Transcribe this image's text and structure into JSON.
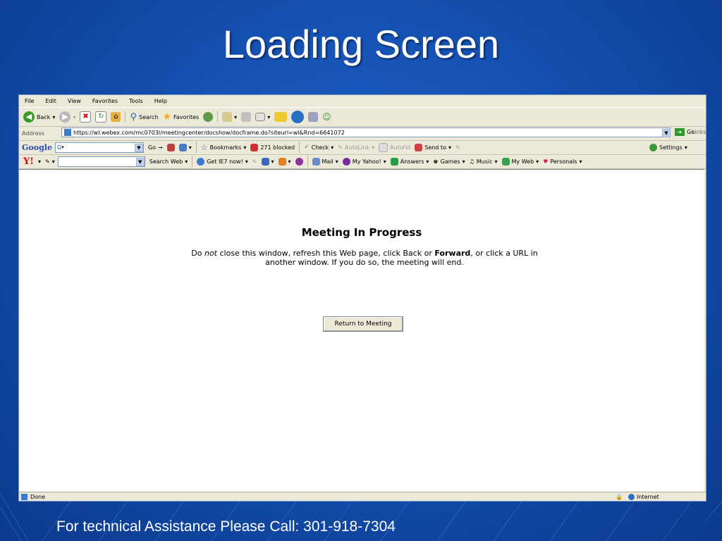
{
  "slide": {
    "title": "Loading Screen",
    "footer": "For technical Assistance Please Call: 301-918-7304"
  },
  "browser": {
    "menu": [
      "File",
      "Edit",
      "View",
      "Favorites",
      "Tools",
      "Help"
    ],
    "toolbar": {
      "back": "Back",
      "search": "Search",
      "favorites": "Favorites"
    },
    "address": {
      "label": "Address",
      "url": "https://wl.webex.com/mc0703l/meetingcenter/docshow/docframe.do?siteurl=wl&Rnd=6641072",
      "go": "Go",
      "links": "Links"
    },
    "google_bar": {
      "logo": "Google",
      "input": "G",
      "go": "Go",
      "bookmarks": "Bookmarks",
      "blocked": "271 blocked",
      "check": "Check",
      "autolink": "AutoLink",
      "autofill": "AutoFill",
      "send_to": "Send to",
      "settings": "Settings"
    },
    "yahoo_bar": {
      "logo": "Y!",
      "search_web": "Search Web",
      "get_ie7": "Get IE7 now!",
      "mail": "Mail",
      "my_yahoo": "My Yahoo!",
      "answers": "Answers",
      "games": "Games",
      "music": "Music",
      "my_web": "My Web",
      "personals": "Personals"
    },
    "page": {
      "heading": "Meeting In Progress",
      "msg_1": "Do ",
      "msg_not": "not",
      "msg_2": " close this window, refresh this Web page, click ",
      "msg_back": "Back",
      "msg_3": " or ",
      "msg_forward": "Forward",
      "msg_4": ", or click a URL in another window. If you do so, the meeting will end.",
      "button": "Return to Meeting"
    },
    "status": {
      "left": "Done",
      "zone": "Internet"
    }
  }
}
